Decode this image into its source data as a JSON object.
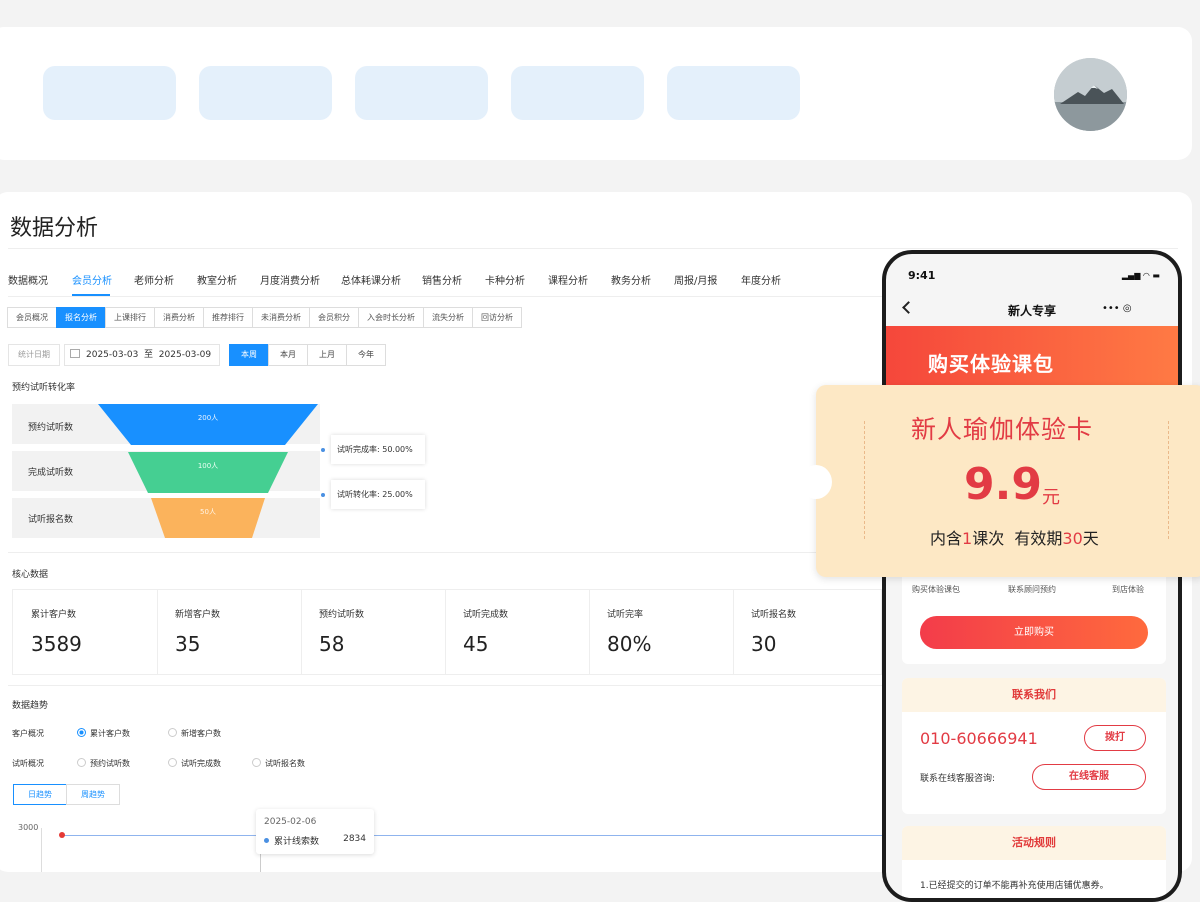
{
  "page": {
    "title": "数据分析"
  },
  "main_tabs": [
    "数据概况",
    "会员分析",
    "老师分析",
    "教室分析",
    "月度消费分析",
    "总体耗课分析",
    "销售分析",
    "卡种分析",
    "课程分析",
    "教务分析",
    "周报/月报",
    "年度分析"
  ],
  "sub_tabs": [
    "会员概况",
    "报名分析",
    "上课排行",
    "消费分析",
    "推荐排行",
    "未消费分析",
    "会员积分",
    "入会时长分析",
    "流失分析",
    "回访分析"
  ],
  "filters": {
    "date_label": "统计日期",
    "date_start": "2025-03-03",
    "date_sep": "至",
    "date_end": "2025-03-09",
    "periods": [
      "本周",
      "本月",
      "上月",
      "今年"
    ]
  },
  "funnel": {
    "title": "预约试听转化率",
    "stages": [
      {
        "label": "预约试听数",
        "value_text": "200人"
      },
      {
        "label": "完成试听数",
        "value_text": "100人"
      },
      {
        "label": "试听报名数",
        "value_text": "50人"
      }
    ],
    "callouts": [
      "试听完成率: 50.00%",
      "试听转化率: 25.00%"
    ],
    "colors": {
      "stage1": "#1890ff",
      "stage2": "#45cf92",
      "stage3": "#fbb35c"
    }
  },
  "core": {
    "title": "核心数据",
    "kpis": [
      {
        "label": "累计客户数",
        "value": "3589"
      },
      {
        "label": "新增客户数",
        "value": "35"
      },
      {
        "label": "预约试听数",
        "value": "58"
      },
      {
        "label": "试听完成数",
        "value": "45"
      },
      {
        "label": "试听完率",
        "value": "80%"
      },
      {
        "label": "试听报名数",
        "value": "30"
      }
    ]
  },
  "trend": {
    "title": "数据趋势",
    "customer_label": "客户概况",
    "customer_options": [
      "累计客户数",
      "新增客户数"
    ],
    "trial_label": "试听概况",
    "trial_options": [
      "预约试听数",
      "试听完成数",
      "试听报名数"
    ],
    "range_tabs": [
      "日趋势",
      "周趋势"
    ],
    "y_tick": "3000",
    "tooltip": {
      "date": "2025-02-06",
      "series": "累计线索数",
      "value": "2834"
    }
  },
  "phone": {
    "time": "9:41",
    "status": "▂▄▆ ◠ ▬",
    "nav_title": "新人专享",
    "capsule": "•••   ◎",
    "banner": "购买体验课包",
    "steps": [
      "购买体验课包",
      "联系顾问预约",
      "到店体验"
    ],
    "buy_button": "立即购买",
    "contact_title": "联系我们",
    "phone_number": "010-60666941",
    "call_button": "拨打",
    "online_label": "联系在线客服咨询:",
    "online_button": "在线客服",
    "rules_title": "活动规则",
    "rules_text": "1.已经提交的订单不能再补充使用店铺优惠券。"
  },
  "ticket": {
    "title": "新人瑜伽体验卡",
    "price": "9.9",
    "unit": "元",
    "sub_a": "内含",
    "sub_count": "1",
    "sub_b": "课次  有效期",
    "sub_days": "30",
    "sub_c": "天"
  }
}
